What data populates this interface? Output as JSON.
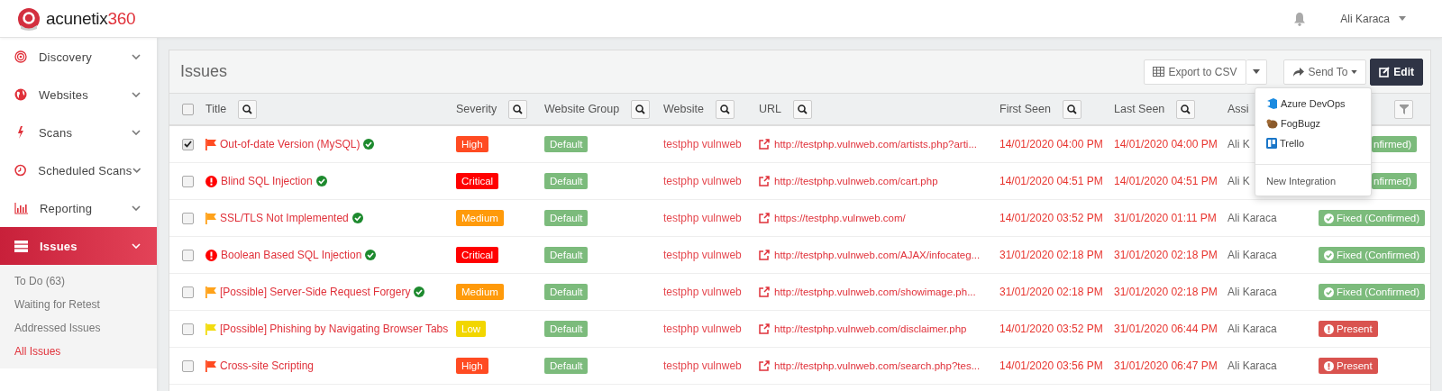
{
  "header": {
    "logo": {
      "name": "acunetix",
      "suffix": "360"
    },
    "user": "Ali Karaca"
  },
  "sidebar": {
    "items": [
      {
        "label": "Discovery",
        "selected": false
      },
      {
        "label": "Websites",
        "selected": false
      },
      {
        "label": "Scans",
        "selected": false
      },
      {
        "label": "Scheduled Scans",
        "selected": false
      },
      {
        "label": "Reporting",
        "selected": false
      },
      {
        "label": "Issues",
        "selected": true,
        "children": [
          {
            "label": "To Do (63)",
            "selected": false
          },
          {
            "label": "Waiting for Retest",
            "selected": false
          },
          {
            "label": "Addressed Issues",
            "selected": false
          },
          {
            "label": "All Issues",
            "selected": true
          }
        ]
      }
    ]
  },
  "panel": {
    "title": "Issues",
    "export_button": "Export to CSV",
    "send_button": "Send To",
    "edit_button": "Edit",
    "send_menu": {
      "items": [
        "Azure DevOps",
        "FogBugz",
        "Trello"
      ],
      "footer": "New Integration"
    }
  },
  "table": {
    "select_all_checked": false,
    "columns": [
      {
        "label": "Title",
        "search": true
      },
      {
        "label": "Severity",
        "search": true
      },
      {
        "label": "Website Group",
        "search": true
      },
      {
        "label": "Website",
        "search": true
      },
      {
        "label": "URL",
        "search": true
      },
      {
        "label": "First Seen",
        "search": true
      },
      {
        "label": "Last Seen",
        "search": true
      },
      {
        "label": "Assi",
        "search": false
      }
    ],
    "rows": [
      {
        "selected": true,
        "title": "Out-of-date Version (MySQL)",
        "verified": true,
        "severity": {
          "text": "High",
          "kind": "high"
        },
        "group": "Default",
        "website": "testphp vulnweb",
        "url": "http://testphp.vulnweb.com/artists.php?arti...",
        "first_seen": "14/01/2020 04:00 PM",
        "last_seen": "14/01/2020 04:00 PM",
        "assignee": "Ali K",
        "status": {
          "text": "nfirmed)",
          "kind": "fixed",
          "partly_hidden": true
        }
      },
      {
        "selected": false,
        "title": "Blind SQL Injection",
        "verified": true,
        "severity": {
          "text": "Critical",
          "kind": "critical"
        },
        "group": "Default",
        "website": "testphp vulnweb",
        "url": "http://testphp.vulnweb.com/cart.php",
        "first_seen": "14/01/2020 04:51 PM",
        "last_seen": "14/01/2020 04:51 PM",
        "assignee": "Ali K",
        "status": {
          "text": "nfirmed)",
          "kind": "fixed",
          "partly_hidden": true
        }
      },
      {
        "selected": false,
        "title": "SSL/TLS Not Implemented",
        "verified": true,
        "severity": {
          "text": "Medium",
          "kind": "medium"
        },
        "group": "Default",
        "website": "testphp vulnweb",
        "url": "https://testphp.vulnweb.com/",
        "first_seen": "14/01/2020 03:52 PM",
        "last_seen": "31/01/2020 01:11 PM",
        "assignee": "Ali Karaca",
        "status": {
          "text": "Fixed (Confirmed)",
          "kind": "fixed",
          "partly_hidden": false
        }
      },
      {
        "selected": false,
        "title": "Boolean Based SQL Injection",
        "verified": true,
        "severity": {
          "text": "Critical",
          "kind": "critical"
        },
        "group": "Default",
        "website": "testphp vulnweb",
        "url": "http://testphp.vulnweb.com/AJAX/infocateg...",
        "first_seen": "31/01/2020 02:18 PM",
        "last_seen": "31/01/2020 02:18 PM",
        "assignee": "Ali Karaca",
        "status": {
          "text": "Fixed (Confirmed)",
          "kind": "fixed",
          "partly_hidden": false
        }
      },
      {
        "selected": false,
        "title": "[Possible] Server-Side Request Forgery",
        "verified": true,
        "severity": {
          "text": "Medium",
          "kind": "medium"
        },
        "group": "Default",
        "website": "testphp vulnweb",
        "url": "http://testphp.vulnweb.com/showimage.ph...",
        "first_seen": "31/01/2020 02:18 PM",
        "last_seen": "31/01/2020 02:18 PM",
        "assignee": "Ali Karaca",
        "status": {
          "text": "Fixed (Confirmed)",
          "kind": "fixed",
          "partly_hidden": false
        }
      },
      {
        "selected": false,
        "title": "[Possible] Phishing by Navigating Browser Tabs",
        "verified": false,
        "severity": {
          "text": "Low",
          "kind": "low"
        },
        "group": "Default",
        "website": "testphp vulnweb",
        "url": "http://testphp.vulnweb.com/disclaimer.php",
        "first_seen": "14/01/2020 03:52 PM",
        "last_seen": "31/01/2020 06:44 PM",
        "assignee": "Ali Karaca",
        "status": {
          "text": "Present",
          "kind": "present",
          "partly_hidden": false
        }
      },
      {
        "selected": false,
        "title": "Cross-site Scripting",
        "verified": false,
        "severity": {
          "text": "High",
          "kind": "high"
        },
        "group": "Default",
        "website": "testphp vulnweb",
        "url": "http://testphp.vulnweb.com/search.php?tes...",
        "first_seen": "14/01/2020 03:56 PM",
        "last_seen": "31/01/2020 06:47 PM",
        "assignee": "Ali Karaca",
        "status": {
          "text": "Present",
          "kind": "present",
          "partly_hidden": false
        }
      }
    ]
  }
}
